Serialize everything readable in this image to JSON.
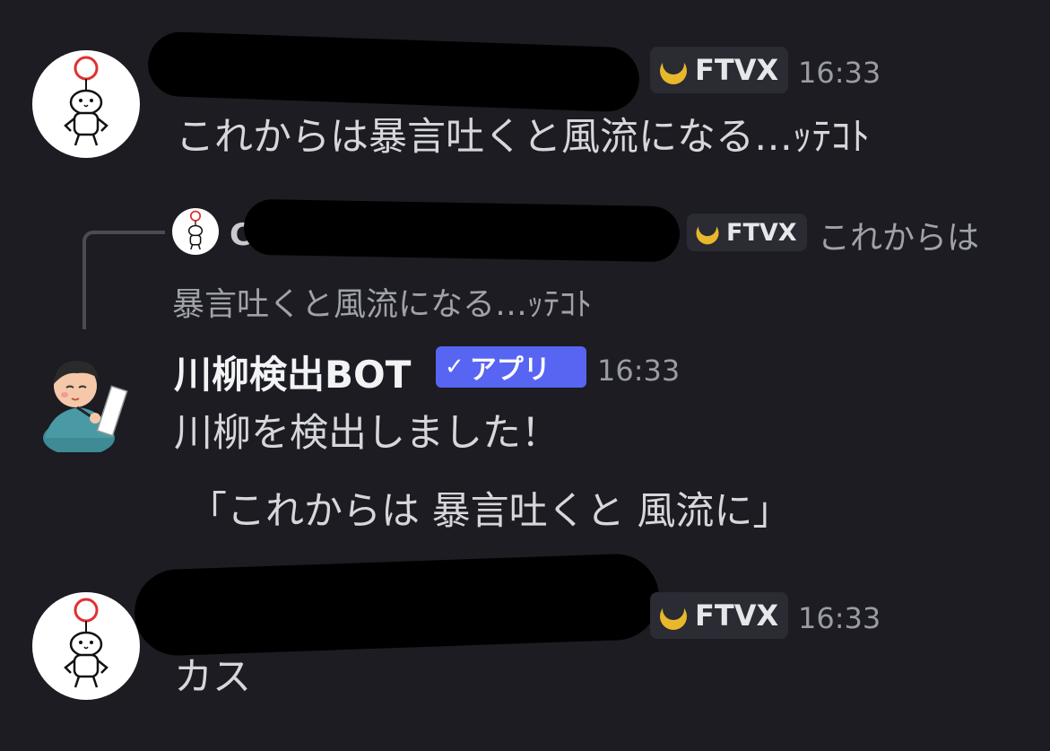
{
  "messages": [
    {
      "author_redacted": true,
      "tag": "FTVX",
      "time": "16:33",
      "text": "これからは暴言吐くと風流になる…ｯﾃｺﾄ"
    },
    {
      "reply": {
        "author_initial": "C",
        "tag": "FTVX",
        "text_line1": "これからは",
        "text_line2": "暴言吐くと風流になる…ｯﾃｺﾄ"
      },
      "author": "川柳検出BOT",
      "badge": "アプリ",
      "badge_check": "✓",
      "time": "16:33",
      "text": "川柳を検出しました！",
      "quote": "「これからは 暴言吐くと 風流に」"
    },
    {
      "author_redacted": true,
      "tag": "FTVX",
      "time": "16:33",
      "text": "カス"
    }
  ],
  "colors": {
    "background": "#1c1c22",
    "tag_bg": "#2a2b33",
    "app_badge": "#5865f2",
    "tag_icon": "#e8b82a"
  },
  "icons": {
    "user_avatar": "doodle-figure-with-balloon",
    "bot_avatar": "haiku-writer-illustration",
    "tag_icon": "crescent-moon-icon",
    "verified_icon": "checkmark-icon"
  }
}
